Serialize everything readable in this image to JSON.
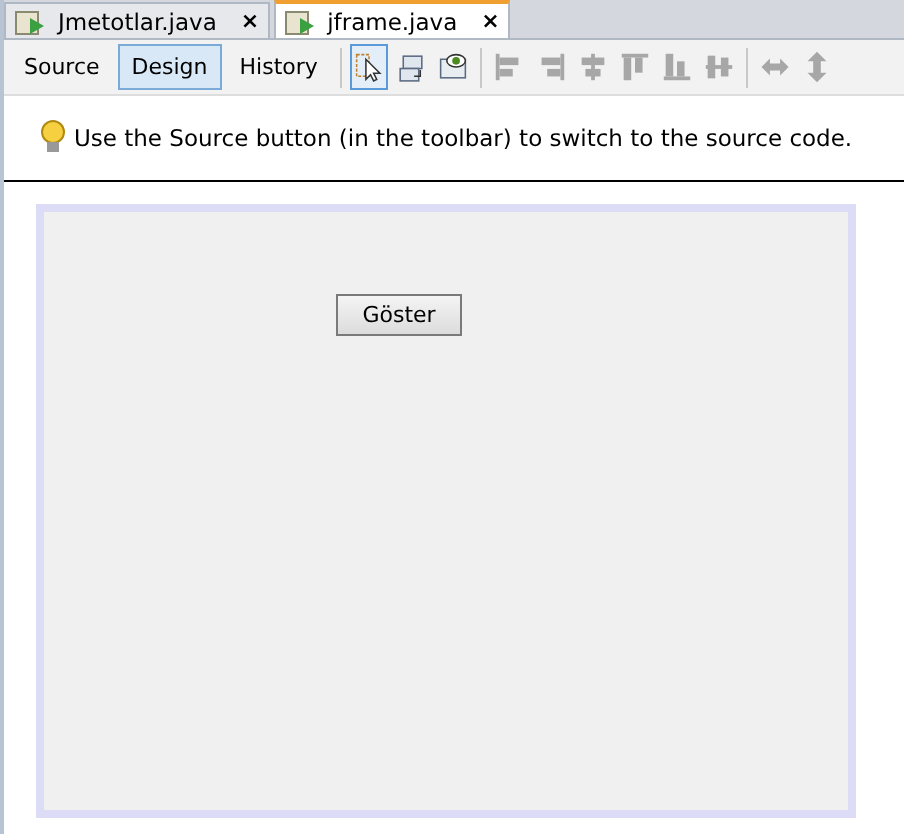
{
  "file_tabs": [
    {
      "label": "Jmetotlar.java",
      "close": "×",
      "selected": false
    },
    {
      "label": "jframe.java",
      "close": "×",
      "selected": true
    }
  ],
  "view_tabs": [
    {
      "label": "Source",
      "selected": false
    },
    {
      "label": "Design",
      "selected": true
    },
    {
      "label": "History",
      "selected": false
    }
  ],
  "tools": [
    {
      "kind": "selection",
      "selected": true,
      "disabled": false
    },
    {
      "kind": "connection",
      "selected": false,
      "disabled": false
    },
    {
      "kind": "preview",
      "selected": false,
      "disabled": false
    },
    {
      "kind": "sep"
    },
    {
      "kind": "align-left",
      "selected": false,
      "disabled": true
    },
    {
      "kind": "align-right",
      "selected": false,
      "disabled": true
    },
    {
      "kind": "center-h",
      "selected": false,
      "disabled": true
    },
    {
      "kind": "align-top",
      "selected": false,
      "disabled": true
    },
    {
      "kind": "align-bottom",
      "selected": false,
      "disabled": true
    },
    {
      "kind": "center-v",
      "selected": false,
      "disabled": true
    },
    {
      "kind": "sep"
    },
    {
      "kind": "resize-h",
      "selected": false,
      "disabled": true
    },
    {
      "kind": "resize-v",
      "selected": false,
      "disabled": true
    }
  ],
  "hint": "Use the Source button (in the toolbar) to switch to the source code.",
  "form": {
    "button": "Göster"
  }
}
